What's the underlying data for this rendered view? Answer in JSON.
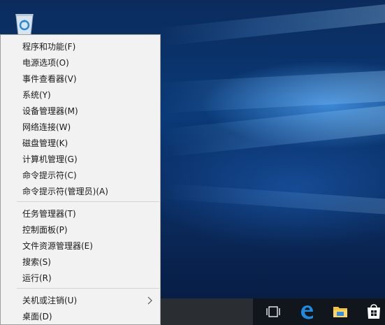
{
  "menu": {
    "groups": [
      [
        {
          "label": "程序和功能(F)",
          "name": "menu-item-programs-and-features"
        },
        {
          "label": "电源选项(O)",
          "name": "menu-item-power-options"
        },
        {
          "label": "事件查看器(V)",
          "name": "menu-item-event-viewer"
        },
        {
          "label": "系统(Y)",
          "name": "menu-item-system"
        },
        {
          "label": "设备管理器(M)",
          "name": "menu-item-device-manager"
        },
        {
          "label": "网络连接(W)",
          "name": "menu-item-network-connections"
        },
        {
          "label": "磁盘管理(K)",
          "name": "menu-item-disk-management"
        },
        {
          "label": "计算机管理(G)",
          "name": "menu-item-computer-management"
        },
        {
          "label": "命令提示符(C)",
          "name": "menu-item-command-prompt"
        },
        {
          "label": "命令提示符(管理员)(A)",
          "name": "menu-item-command-prompt-admin"
        }
      ],
      [
        {
          "label": "任务管理器(T)",
          "name": "menu-item-task-manager"
        },
        {
          "label": "控制面板(P)",
          "name": "menu-item-control-panel"
        },
        {
          "label": "文件资源管理器(E)",
          "name": "menu-item-file-explorer"
        },
        {
          "label": "搜索(S)",
          "name": "menu-item-search"
        },
        {
          "label": "运行(R)",
          "name": "menu-item-run"
        }
      ],
      [
        {
          "label": "关机或注销(U)",
          "name": "menu-item-shutdown-or-sign-out",
          "submenu": true
        },
        {
          "label": "桌面(D)",
          "name": "menu-item-desktop"
        }
      ]
    ]
  },
  "taskbar": {
    "icons": [
      "task-view-icon",
      "edge-icon",
      "file-explorer-icon",
      "store-icon"
    ]
  },
  "desktop": {
    "icons": [
      "recycle-bin-icon"
    ]
  }
}
